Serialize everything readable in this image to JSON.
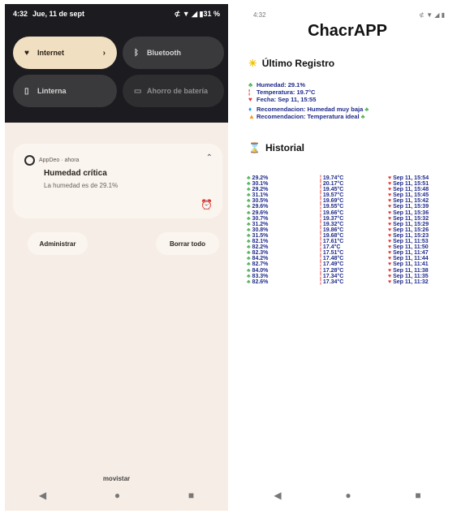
{
  "left": {
    "status": {
      "time": "4:32",
      "date": "Jue, 11 de sept",
      "icons": "⊄ ▼ ◢ ▮31 %"
    },
    "tiles": [
      {
        "label": "Internet",
        "icon": "wifi-icon"
      },
      {
        "label": "Bluetooth",
        "icon": "bluetooth-icon"
      },
      {
        "label": "Linterna",
        "icon": "flashlight-icon"
      },
      {
        "label": "Ahorro de batería",
        "icon": "battery-saver-icon"
      }
    ],
    "notification": {
      "app_line": "AppDeo · ahora",
      "title": "Humedad crítica",
      "body": "La humedad es de 29.1%"
    },
    "buttons": {
      "manage": "Administrar",
      "clear_all": "Borrar todo"
    },
    "bottom_label": "movistar"
  },
  "right": {
    "status": {
      "time": "4:32",
      "icons": "⊄ ▼ ◢ ▮"
    },
    "app_title": "ChacrAPP",
    "last_record": {
      "heading": "Último Registro",
      "humidity": "Humedad: 29.1%",
      "temperature": "Temperatura: 19.7°C",
      "date": "Fecha: Sep 11, 15:55",
      "rec1": "Recomendacion: Humedad muy baja",
      "rec2": "Recomendacion: Temperatura ideal"
    },
    "history_heading": "Historial",
    "history": [
      {
        "h": "29.2%",
        "t": "19.74°C",
        "d": "Sep 11, 15:54"
      },
      {
        "h": "30.1%",
        "t": "20.17°C",
        "d": "Sep 11, 15:51"
      },
      {
        "h": "29.2%",
        "t": "19.45°C",
        "d": "Sep 11, 15:48"
      },
      {
        "h": "31.1%",
        "t": "19.57°C",
        "d": "Sep 11, 15:45"
      },
      {
        "h": "30.5%",
        "t": "19.69°C",
        "d": "Sep 11, 15:42"
      },
      {
        "h": "29.6%",
        "t": "19.55°C",
        "d": "Sep 11, 15:39"
      },
      {
        "h": "29.6%",
        "t": "19.66°C",
        "d": "Sep 11, 15:36"
      },
      {
        "h": "30.7%",
        "t": "19.37°C",
        "d": "Sep 11, 15:32"
      },
      {
        "h": "31.2%",
        "t": "19.32°C",
        "d": "Sep 11, 15:29"
      },
      {
        "h": "30.8%",
        "t": "19.86°C",
        "d": "Sep 11, 15:26"
      },
      {
        "h": "31.5%",
        "t": "19.68°C",
        "d": "Sep 11, 15:23"
      },
      {
        "h": "82.1%",
        "t": "17.61°C",
        "d": "Sep 11, 11:53"
      },
      {
        "h": "82.2%",
        "t": "17.4°C",
        "d": "Sep 11, 11:50"
      },
      {
        "h": "82.3%",
        "t": "17.51°C",
        "d": "Sep 11, 11:47"
      },
      {
        "h": "84.2%",
        "t": "17.48°C",
        "d": "Sep 11, 11:44"
      },
      {
        "h": "82.7%",
        "t": "17.49°C",
        "d": "Sep 11, 11:41"
      },
      {
        "h": "84.0%",
        "t": "17.28°C",
        "d": "Sep 11, 11:38"
      },
      {
        "h": "83.3%",
        "t": "17.34°C",
        "d": "Sep 11, 11:35"
      },
      {
        "h": "82.6%",
        "t": "17.34°C",
        "d": "Sep 11, 11:32"
      }
    ]
  },
  "nav": {
    "back": "◀",
    "home": "●",
    "recents": "■"
  },
  "colors": {
    "tile_on": "#f1dfc2",
    "shade_dark": "#1c1b1f",
    "panel_bg": "#f6ede6",
    "text_blue": "#1f2a8a"
  }
}
